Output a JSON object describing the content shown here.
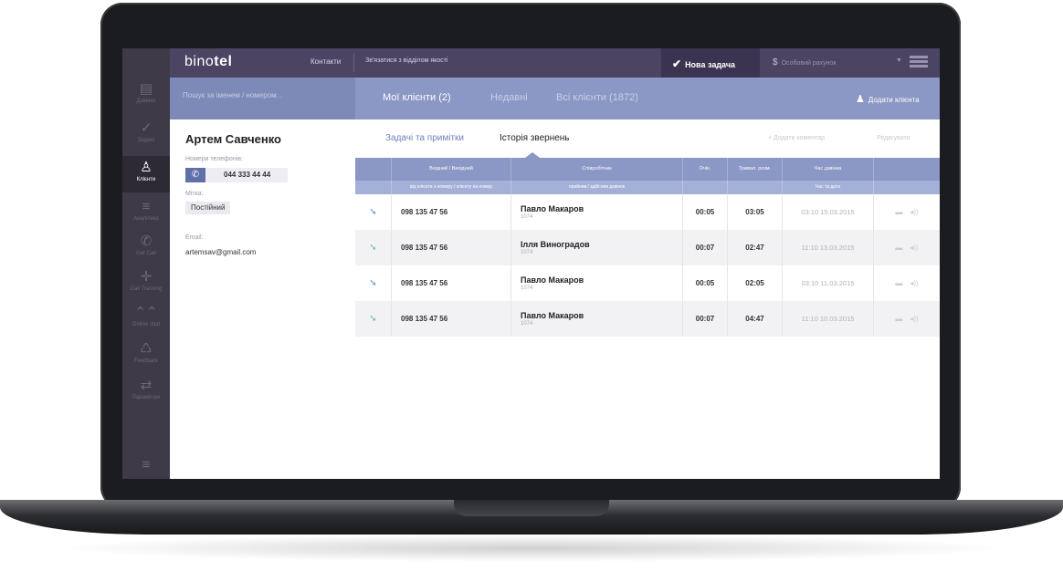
{
  "app": {
    "logo_light": "bino",
    "logo_bold": "tel"
  },
  "topbar": {
    "contacts": "Контакти",
    "quality": "Зв'язатися з відділом якості",
    "new_task": "Нова задача",
    "account": "Особовий рахунок"
  },
  "rail": {
    "items": [
      {
        "label": "Дзвінки",
        "icon": "list-icon"
      },
      {
        "label": "Задачі",
        "icon": "check-icon"
      },
      {
        "label": "Клієнти",
        "icon": "user-icon"
      },
      {
        "label": "Аналітика",
        "icon": "bars-icon"
      },
      {
        "label": "Get Call",
        "icon": "phone-icon"
      },
      {
        "label": "Call Tracking",
        "icon": "crosshair-icon"
      },
      {
        "label": "Online chat",
        "icon": "chat-icon"
      },
      {
        "label": "Feedback",
        "icon": "feedback-icon"
      },
      {
        "label": "Параметри",
        "icon": "sliders-icon"
      }
    ]
  },
  "search": {
    "placeholder": "Пошук за іменем / номером..."
  },
  "client_tabs": [
    {
      "label": "Мої клієнти (2)",
      "active": true
    },
    {
      "label": "Недавні",
      "active": false
    },
    {
      "label": "Всі клієнти (1872)",
      "active": false
    }
  ],
  "add_client": "Додати клієнта",
  "client": {
    "name": "Артем Савченко",
    "phones_label": "Номери телефонів:",
    "phone": "044 333 44 44",
    "tag_label": "Мітка:",
    "tag": "Постійний",
    "email_label": "Email:",
    "email": "artemsav@gmail.com"
  },
  "subtabs": [
    {
      "label": "Задачі та примітки",
      "active": false
    },
    {
      "label": "Історія звернень",
      "active": true
    }
  ],
  "add_comment": "+ Додати коментар",
  "edit": "Редагувати",
  "table": {
    "headers": [
      "Вхідний / Вихідний",
      "Співробітник",
      "Очік.",
      "Тривал. розм.",
      "Час дзвінка"
    ],
    "subheaders": [
      "від клієнта з номеру / клієнту на номер",
      "прийняв / здійснив дзвінок",
      "Час та дата"
    ],
    "rows": [
      {
        "direction": "incoming",
        "number": "098 135 47 56",
        "employee": "Павло Макаров",
        "ext": "1074",
        "wait": "00:05",
        "duration": "03:05",
        "time": "03:10 15.03.2015"
      },
      {
        "direction": "outgoing",
        "number": "098 135 47 56",
        "employee": "Ілля Виноградов",
        "ext": "1074",
        "wait": "00:07",
        "duration": "02:47",
        "time": "11:10 13.03.2015"
      },
      {
        "direction": "incoming",
        "number": "098 135 47 56",
        "employee": "Павло Макаров",
        "ext": "1074",
        "wait": "00:05",
        "duration": "02:05",
        "time": "03:10 11.03.2015"
      },
      {
        "direction": "outgoing",
        "number": "098 135 47 56",
        "employee": "Павло Макаров",
        "ext": "1074",
        "wait": "00:07",
        "duration": "04:47",
        "time": "11:10 10.03.2015"
      }
    ]
  },
  "colors": {
    "topbar": "#4c4463",
    "accent": "#8b97c4",
    "rail": "#3e3a48",
    "incoming_arrow": "#5c8ed6",
    "outgoing_arrow": "#6fb9a4"
  }
}
